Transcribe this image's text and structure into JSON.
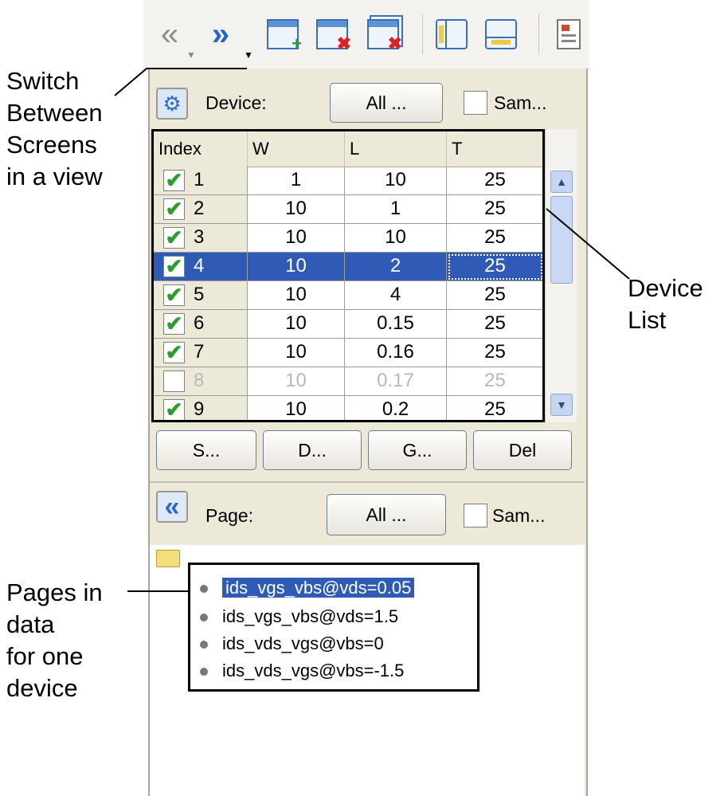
{
  "toolbar": {
    "buttons": [
      {
        "icon": "double-left-arrow-icon",
        "glyph": "«"
      },
      {
        "icon": "double-right-arrow-icon",
        "glyph": "»"
      },
      {
        "icon": "new-window-icon",
        "badge": "+"
      },
      {
        "icon": "close-window-icon",
        "badge": "✖"
      },
      {
        "icon": "close-all-windows-icon",
        "badge": "✖"
      },
      {
        "icon": "split-vertical-icon"
      },
      {
        "icon": "split-horizontal-icon"
      },
      {
        "icon": "report-icon"
      }
    ]
  },
  "device_header": {
    "label": "Device:",
    "all_button": "All ...",
    "same_label": "Sam..."
  },
  "table": {
    "columns": [
      "Index",
      "W",
      "L",
      "T"
    ],
    "rows": [
      {
        "index": "1",
        "w": "1",
        "l": "10",
        "t": "25",
        "checked": true,
        "selected": false,
        "disabled": false
      },
      {
        "index": "2",
        "w": "10",
        "l": "1",
        "t": "25",
        "checked": true,
        "selected": false,
        "disabled": false
      },
      {
        "index": "3",
        "w": "10",
        "l": "10",
        "t": "25",
        "checked": true,
        "selected": false,
        "disabled": false
      },
      {
        "index": "4",
        "w": "10",
        "l": "2",
        "t": "25",
        "checked": true,
        "selected": true,
        "disabled": false
      },
      {
        "index": "5",
        "w": "10",
        "l": "4",
        "t": "25",
        "checked": true,
        "selected": false,
        "disabled": false
      },
      {
        "index": "6",
        "w": "10",
        "l": "0.15",
        "t": "25",
        "checked": true,
        "selected": false,
        "disabled": false
      },
      {
        "index": "7",
        "w": "10",
        "l": "0.16",
        "t": "25",
        "checked": true,
        "selected": false,
        "disabled": false
      },
      {
        "index": "8",
        "w": "10",
        "l": "0.17",
        "t": "25",
        "checked": false,
        "selected": false,
        "disabled": true
      },
      {
        "index": "9",
        "w": "10",
        "l": "0.2",
        "t": "25",
        "checked": true,
        "selected": false,
        "disabled": false
      }
    ]
  },
  "action_buttons": [
    "S...",
    "D...",
    "G...",
    "Del"
  ],
  "page_header": {
    "label": "Page:",
    "all_button": "All ...",
    "same_label": "Sam..."
  },
  "pages": [
    {
      "label": "ids_vgs_vbs@vds=0.05",
      "selected": true
    },
    {
      "label": "ids_vgs_vbs@vds=1.5",
      "selected": false
    },
    {
      "label": "ids_vds_vgs@vbs=0",
      "selected": false
    },
    {
      "label": "ids_vds_vgs@vbs=-1.5",
      "selected": false
    }
  ],
  "annotations": {
    "switch_screens": [
      "Switch",
      "Between",
      "Screens",
      "in a view"
    ],
    "device_list": [
      "Device",
      "List"
    ],
    "pages_in_data": [
      "Pages in",
      "data",
      "for one",
      "device"
    ]
  },
  "colors": {
    "selection": "#2f5bb7",
    "check": "#2d9b2d",
    "panel_bg": "#ece9d8"
  }
}
